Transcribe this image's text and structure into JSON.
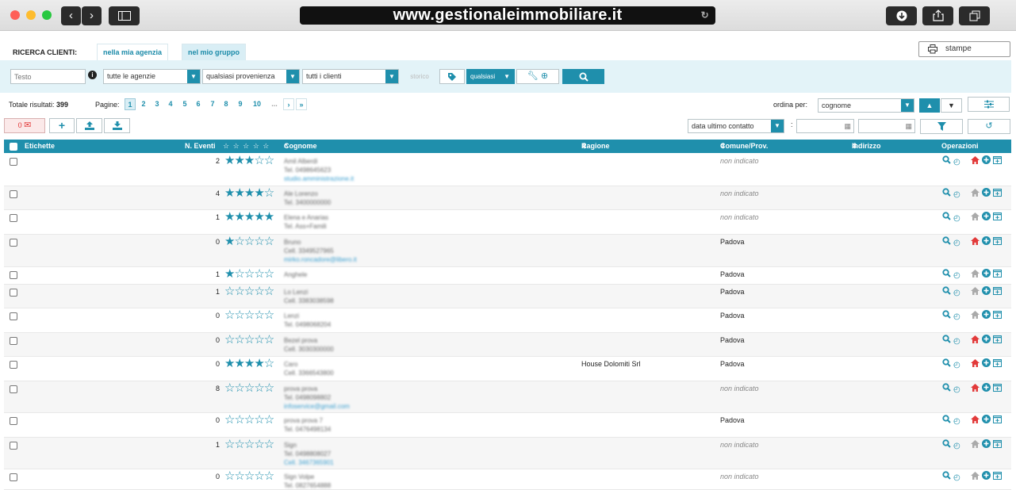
{
  "browser": {
    "url": "www.gestionaleimmobiliare.it"
  },
  "search": {
    "label": "RICERCA CLIENTI:",
    "tabs": [
      "nella mia agenzia",
      "nel mio gruppo"
    ],
    "print_label": "stampe",
    "text_placeholder": "Testo",
    "agency_select": "tutte le agenzie",
    "provenance_select": "qualsiasi provenienza",
    "clients_select": "tutti i clienti",
    "history_label": "storico",
    "tag_select": "qualsiasi"
  },
  "results": {
    "total_label": "Totale risultati:",
    "total": "399",
    "pages_label": "Pagine:",
    "pages": [
      "1",
      "2",
      "3",
      "4",
      "5",
      "6",
      "7",
      "8",
      "9",
      "10",
      "..."
    ],
    "current_page": "1",
    "order_label": "ordina per:",
    "order_value": "cognome",
    "mail_count": "0",
    "date_filter": "data ultimo contatto",
    "date_sep": ":"
  },
  "table": {
    "headers": {
      "labels": "Etichette",
      "events": "N. Eventi",
      "name": "Cognome / Nome / Contatti",
      "company": "Ragione sociale",
      "city": "Comune/Prov.",
      "address": "Indirizzo",
      "ops": "Operazioni"
    },
    "rows": [
      {
        "events": "2",
        "rating": 3,
        "l1": "Amil Alberdi",
        "l2": "Tel. 0498645623",
        "l3": "studio.amministrazione.it",
        "company": "",
        "city": "non indicato",
        "home_red": true
      },
      {
        "events": "4",
        "rating": 4,
        "l1": "Ale Lorenzo",
        "l2": "Tel. 3400000000",
        "l3": "",
        "company": "",
        "city": "non indicato",
        "home_red": false
      },
      {
        "events": "1",
        "rating": 5,
        "l1": "Elena e Anarias",
        "l2": "Tel. Ass+Famili",
        "l3": "",
        "company": "",
        "city": "non indicato",
        "home_red": false
      },
      {
        "events": "0",
        "rating": 1,
        "l1": "Bruno",
        "l2": "Cell. 3349527965",
        "l3": "mirko.roncadore@libero.it",
        "company": "",
        "city": "Padova",
        "home_red": true
      },
      {
        "events": "1",
        "rating": 1,
        "l1": "Anghele",
        "l2": "",
        "l3": "",
        "company": "",
        "city": "Padova",
        "home_red": false
      },
      {
        "events": "1",
        "rating": 0,
        "l1": "Lo Lenzi",
        "l2": "Cell. 3383038598",
        "l3": "",
        "company": "",
        "city": "Padova",
        "home_red": false
      },
      {
        "events": "0",
        "rating": 0,
        "l1": "Lenzi",
        "l2": "Tel. 0498068204",
        "l3": "",
        "company": "",
        "city": "Padova",
        "home_red": false
      },
      {
        "events": "0",
        "rating": 0,
        "l1": "Bezel prova",
        "l2": "Cell. 3030300000",
        "l3": "",
        "company": "",
        "city": "Padova",
        "home_red": true
      },
      {
        "events": "0",
        "rating": 4,
        "l1": "Caro",
        "l2": "Cell. 3366543800",
        "l3": "",
        "company": "House Dolomiti Srl",
        "city": "Padova",
        "home_red": true
      },
      {
        "events": "8",
        "rating": 0,
        "l1": "prova prova",
        "l2": "Tel. 0498098802",
        "l3": "infoservice@gmail.com",
        "company": "",
        "city": "non indicato",
        "home_red": true
      },
      {
        "events": "0",
        "rating": 0,
        "l1": "prova prova 7",
        "l2": "Tel. 0476498134",
        "l3": "",
        "company": "",
        "city": "Padova",
        "home_red": true
      },
      {
        "events": "1",
        "rating": 0,
        "l1": "Sign",
        "l2": "Tel. 0498808027",
        "l3": "Cell. 3467365901",
        "company": "",
        "city": "non indicato",
        "home_red": false
      },
      {
        "events": "0",
        "rating": 0,
        "l1": "Sign Volpe",
        "l2": "Tel. 0827654888",
        "l3": "",
        "company": "",
        "city": "non indicato",
        "home_red": false
      }
    ]
  },
  "icons": {
    "accent": "#1f8fac",
    "danger": "#e23a3a"
  }
}
